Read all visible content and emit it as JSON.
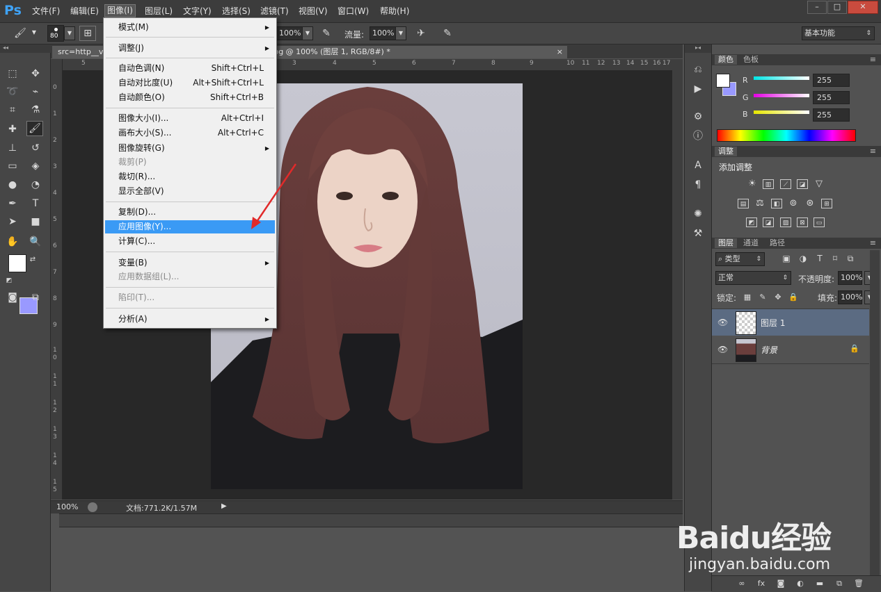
{
  "app": {
    "logo": "Ps"
  },
  "menubar": {
    "items": [
      "文件(F)",
      "编辑(E)",
      "图像(I)",
      "图层(L)",
      "文字(Y)",
      "选择(S)",
      "滤镜(T)",
      "视图(V)",
      "窗口(W)",
      "帮助(H)"
    ],
    "active_index": 2
  },
  "window_controls": {
    "minimize": "–",
    "restore": "□",
    "close": "✕"
  },
  "options_bar": {
    "brush_size": "80",
    "opacity_value": "100%",
    "flow_label": "流量:",
    "flow_value": "100%",
    "workspace": "基本功能"
  },
  "document": {
    "tab_title": "src=http__v...005_12.jpg&refer=http__www.faxingzhan.jpg @ 100% (图层 1, RGB/8#) *",
    "tab_close": "×",
    "ruler_h": [
      "5",
      "3",
      "4",
      "5",
      "6",
      "7",
      "8",
      "9",
      "10",
      "11",
      "12",
      "13",
      "14",
      "15",
      "16",
      "17"
    ],
    "ruler_v": [
      "0",
      "1",
      "2",
      "3",
      "4",
      "5",
      "6",
      "7",
      "8",
      "9",
      "1 0",
      "1 1",
      "1 2",
      "1 3",
      "1 4",
      "1 5"
    ],
    "zoom": "100%",
    "doc_info": "文档:771.2K/1.57M"
  },
  "image_menu": {
    "items": [
      {
        "label": "模式(M)",
        "shortcut": "",
        "submenu": true,
        "disabled": false
      },
      {
        "label": "调整(J)",
        "shortcut": "",
        "submenu": true,
        "disabled": false
      },
      {
        "label": "自动色调(N)",
        "shortcut": "Shift+Ctrl+L",
        "submenu": false,
        "disabled": false
      },
      {
        "label": "自动对比度(U)",
        "shortcut": "Alt+Shift+Ctrl+L",
        "submenu": false,
        "disabled": false
      },
      {
        "label": "自动颜色(O)",
        "shortcut": "Shift+Ctrl+B",
        "submenu": false,
        "disabled": false
      },
      {
        "label": "图像大小(I)...",
        "shortcut": "Alt+Ctrl+I",
        "submenu": false,
        "disabled": false
      },
      {
        "label": "画布大小(S)...",
        "shortcut": "Alt+Ctrl+C",
        "submenu": false,
        "disabled": false
      },
      {
        "label": "图像旋转(G)",
        "shortcut": "",
        "submenu": true,
        "disabled": false
      },
      {
        "label": "裁剪(P)",
        "shortcut": "",
        "submenu": false,
        "disabled": true
      },
      {
        "label": "裁切(R)...",
        "shortcut": "",
        "submenu": false,
        "disabled": false
      },
      {
        "label": "显示全部(V)",
        "shortcut": "",
        "submenu": false,
        "disabled": false
      },
      {
        "label": "复制(D)...",
        "shortcut": "",
        "submenu": false,
        "disabled": false
      },
      {
        "label": "应用图像(Y)...",
        "shortcut": "",
        "submenu": false,
        "disabled": false,
        "highlighted": true
      },
      {
        "label": "计算(C)...",
        "shortcut": "",
        "submenu": false,
        "disabled": false
      },
      {
        "label": "变量(B)",
        "shortcut": "",
        "submenu": true,
        "disabled": false
      },
      {
        "label": "应用数据组(L)...",
        "shortcut": "",
        "submenu": false,
        "disabled": true
      },
      {
        "label": "陷印(T)...",
        "shortcut": "",
        "submenu": false,
        "disabled": true
      },
      {
        "label": "分析(A)",
        "shortcut": "",
        "submenu": true,
        "disabled": false
      }
    ]
  },
  "color_panel": {
    "tabs": [
      "颜色",
      "色板"
    ],
    "channels": [
      {
        "label": "R",
        "value": "255",
        "color": "#00e5e5"
      },
      {
        "label": "G",
        "value": "255",
        "color": "#e500e5"
      },
      {
        "label": "B",
        "value": "255",
        "color": "#e5e500"
      }
    ]
  },
  "adjustments_panel": {
    "tab": "调整",
    "title": "添加调整"
  },
  "layers_panel": {
    "tabs": [
      "图层",
      "通道",
      "路径"
    ],
    "filter_kind": "类型",
    "blend_mode": "正常",
    "opacity_label": "不透明度:",
    "opacity_value": "100%",
    "lock_label": "锁定:",
    "fill_label": "填充:",
    "fill_value": "100%",
    "layers": [
      {
        "name": "图层 1",
        "selected": true,
        "locked": false
      },
      {
        "name": "背景",
        "selected": false,
        "locked": true
      }
    ]
  },
  "watermark": {
    "brand": "Baidu经验",
    "url": "jingyan.baidu.com"
  },
  "colors": {
    "highlight": "#3a9af5",
    "background_swatch": "#9999ff",
    "foreground_swatch": "#ffffff"
  }
}
